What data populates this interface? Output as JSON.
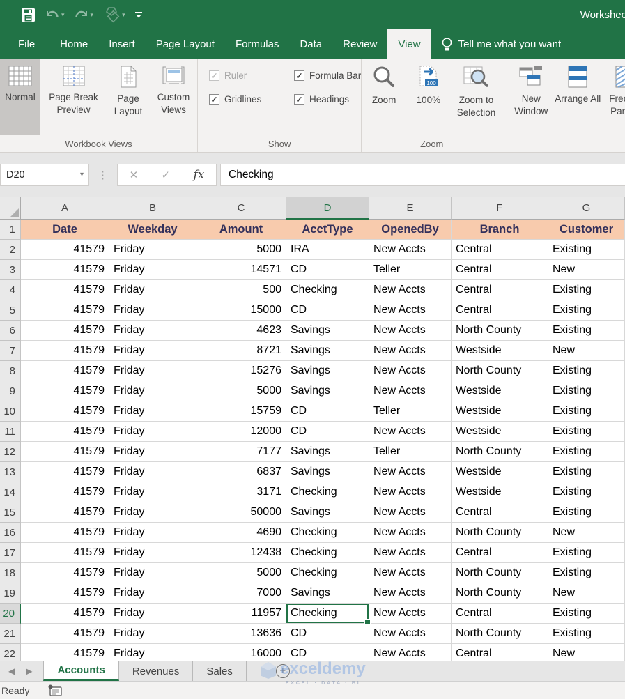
{
  "titlebar": {
    "title": "Workshee",
    "icons": [
      "save-icon",
      "undo-icon",
      "redo-icon",
      "shapes-icon",
      "qat-customize-icon"
    ]
  },
  "ribbon_tabs": {
    "items": [
      {
        "label": "File"
      },
      {
        "label": "Home"
      },
      {
        "label": "Insert"
      },
      {
        "label": "Page Layout"
      },
      {
        "label": "Formulas"
      },
      {
        "label": "Data"
      },
      {
        "label": "Review"
      },
      {
        "label": "View",
        "active": true
      }
    ],
    "tell_me": "Tell me what you want"
  },
  "ribbon": {
    "workbook_views": {
      "label": "Workbook Views",
      "items": [
        {
          "label": "Normal",
          "active": true
        },
        {
          "label": "Page Break Preview"
        },
        {
          "label": "Page Layout"
        },
        {
          "label": "Custom Views"
        }
      ]
    },
    "show": {
      "label": "Show",
      "items": [
        {
          "label": "Ruler",
          "checked": true,
          "disabled": true
        },
        {
          "label": "Formula Bar",
          "checked": true
        },
        {
          "label": "Gridlines",
          "checked": true
        },
        {
          "label": "Headings",
          "checked": true
        }
      ]
    },
    "zoom": {
      "label": "Zoom",
      "items": [
        {
          "label": "Zoom"
        },
        {
          "label": "100%",
          "badge": "100"
        },
        {
          "label": "Zoom to Selection"
        }
      ]
    },
    "window": {
      "items": [
        {
          "label": "New Window"
        },
        {
          "label": "Arrange All"
        },
        {
          "label": "Freeze Panes"
        }
      ]
    }
  },
  "formula_bar": {
    "name_box": "D20",
    "fx_label": "fx",
    "formula": "Checking"
  },
  "grid": {
    "columns": [
      "A",
      "B",
      "C",
      "D",
      "E",
      "F",
      "G"
    ],
    "selected": {
      "cell": "D20",
      "col": "D",
      "row": 20
    },
    "field_headers": [
      "Date",
      "Weekday",
      "Amount",
      "AcctType",
      "OpenedBy",
      "Branch",
      "Customer"
    ],
    "rows": [
      [
        41579,
        "Friday",
        5000,
        "IRA",
        "New Accts",
        "Central",
        "Existing"
      ],
      [
        41579,
        "Friday",
        14571,
        "CD",
        "Teller",
        "Central",
        "New"
      ],
      [
        41579,
        "Friday",
        500,
        "Checking",
        "New Accts",
        "Central",
        "Existing"
      ],
      [
        41579,
        "Friday",
        15000,
        "CD",
        "New Accts",
        "Central",
        "Existing"
      ],
      [
        41579,
        "Friday",
        4623,
        "Savings",
        "New Accts",
        "North County",
        "Existing"
      ],
      [
        41579,
        "Friday",
        8721,
        "Savings",
        "New Accts",
        "Westside",
        "New"
      ],
      [
        41579,
        "Friday",
        15276,
        "Savings",
        "New Accts",
        "North County",
        "Existing"
      ],
      [
        41579,
        "Friday",
        5000,
        "Savings",
        "New Accts",
        "Westside",
        "Existing"
      ],
      [
        41579,
        "Friday",
        15759,
        "CD",
        "Teller",
        "Westside",
        "Existing"
      ],
      [
        41579,
        "Friday",
        12000,
        "CD",
        "New Accts",
        "Westside",
        "Existing"
      ],
      [
        41579,
        "Friday",
        7177,
        "Savings",
        "Teller",
        "North County",
        "Existing"
      ],
      [
        41579,
        "Friday",
        6837,
        "Savings",
        "New Accts",
        "Westside",
        "Existing"
      ],
      [
        41579,
        "Friday",
        3171,
        "Checking",
        "New Accts",
        "Westside",
        "Existing"
      ],
      [
        41579,
        "Friday",
        50000,
        "Savings",
        "New Accts",
        "Central",
        "Existing"
      ],
      [
        41579,
        "Friday",
        4690,
        "Checking",
        "New Accts",
        "North County",
        "New"
      ],
      [
        41579,
        "Friday",
        12438,
        "Checking",
        "New Accts",
        "Central",
        "Existing"
      ],
      [
        41579,
        "Friday",
        5000,
        "Checking",
        "New Accts",
        "North County",
        "Existing"
      ],
      [
        41579,
        "Friday",
        7000,
        "Savings",
        "New Accts",
        "North County",
        "New"
      ],
      [
        41579,
        "Friday",
        11957,
        "Checking",
        "New Accts",
        "Central",
        "Existing"
      ],
      [
        41579,
        "Friday",
        13636,
        "CD",
        "New Accts",
        "North County",
        "Existing"
      ],
      [
        41579,
        "Friday",
        16000,
        "CD",
        "New Accts",
        "Central",
        "New"
      ]
    ],
    "colors": {
      "field_header_bg": "#F8CBAD",
      "field_header_text": "#33305B",
      "selection_green": "#217346"
    }
  },
  "sheet_tabs": {
    "tabs": [
      {
        "label": "Accounts",
        "active": true
      },
      {
        "label": "Revenues"
      },
      {
        "label": "Sales"
      }
    ],
    "add_label": "+"
  },
  "status_bar": {
    "ready": "Ready"
  },
  "watermark": {
    "text": "exceldemy",
    "subtext": "EXCEL · DATA · BI"
  },
  "colors": {
    "excel_green": "#217346",
    "ribbon_bg": "#F3F2F1"
  }
}
